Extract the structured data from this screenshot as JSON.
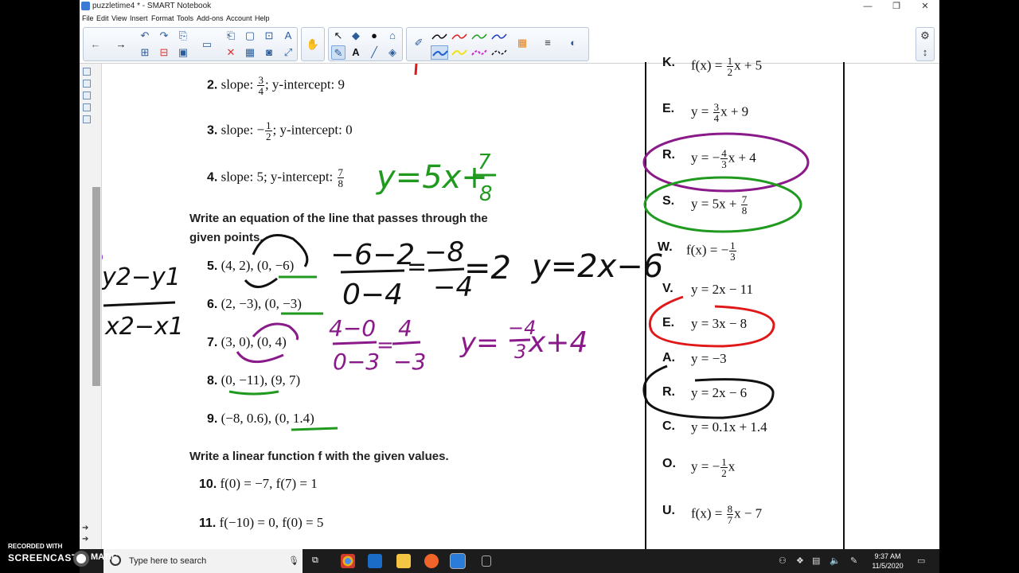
{
  "window": {
    "title": "puzzletime4 * - SMART Notebook",
    "controls": [
      "—",
      "❐",
      "✕"
    ]
  },
  "menu": [
    "File",
    "Edit",
    "View",
    "Insert",
    "Format",
    "Tools",
    "Add-ons",
    "Account",
    "Help"
  ],
  "toolbar": {
    "pen_colors": [
      "#111111",
      "#e02020",
      "#22a022",
      "#2040c0",
      "#1f5fd0",
      "#f2e21a",
      "#d020d0",
      "#111111"
    ]
  },
  "worksheet": {
    "slope_problems": [
      {
        "num": "2.",
        "pre": "slope: ",
        "frac": [
          "3",
          "4"
        ],
        "post": "; y-intercept: 9"
      },
      {
        "num": "3.",
        "pre": "slope: −",
        "frac": [
          "1",
          "2"
        ],
        "post": "; y-intercept: 0"
      },
      {
        "num": "4.",
        "pre": "slope: 5; y-intercept: ",
        "frac": [
          "7",
          "8"
        ],
        "post": ""
      }
    ],
    "heading_points_line1": "Write an equation of the line that passes through the",
    "heading_points_line2": "given points.",
    "point_problems": [
      {
        "num": "5.",
        "text": "(4, 2), (0, −6)"
      },
      {
        "num": "6.",
        "text": "(2, −3), (0, −3)"
      },
      {
        "num": "7.",
        "text": "(3, 0), (0, 4)"
      },
      {
        "num": "8.",
        "text": "(0, −11), (9, 7)"
      },
      {
        "num": "9.",
        "text": "(−8, 0.6), (0, 1.4)"
      }
    ],
    "heading_function": "Write a linear function f with the given values.",
    "function_problems": [
      {
        "num": "10.",
        "text": "f(0) = −7, f(7) = 1"
      },
      {
        "num": "11.",
        "text": "f(−10) = 0, f(0) = 5"
      }
    ]
  },
  "answers": [
    {
      "letter": "K.",
      "pre": "f(x) = ",
      "frac": [
        "1",
        "2"
      ],
      "post": "x + 5"
    },
    {
      "letter": "E.",
      "pre": "y = ",
      "frac": [
        "3",
        "4"
      ],
      "post": "x + 9"
    },
    {
      "letter": "R.",
      "pre": "y = −",
      "frac": [
        "4",
        "3"
      ],
      "post": "x + 4"
    },
    {
      "letter": "S.",
      "pre": "y = 5x + ",
      "frac": [
        "7",
        "8"
      ],
      "post": ""
    },
    {
      "letter": "W.",
      "pre": "f(x) = −",
      "frac": [
        "1",
        "3"
      ],
      "post": ""
    },
    {
      "letter": "V.",
      "pre": "y = 2x − 11",
      "frac": null,
      "post": ""
    },
    {
      "letter": "E.",
      "pre": "y = 3x − 8",
      "frac": null,
      "post": ""
    },
    {
      "letter": "A.",
      "pre": "y = −3",
      "frac": null,
      "post": ""
    },
    {
      "letter": "R.",
      "pre": "y = 2x − 6",
      "frac": null,
      "post": ""
    },
    {
      "letter": "C.",
      "pre": "y = 0.1x + 1.4",
      "frac": null,
      "post": ""
    },
    {
      "letter": "O.",
      "pre": "y = −",
      "frac": [
        "1",
        "2"
      ],
      "post": "x"
    },
    {
      "letter": "U.",
      "pre": "f(x) = ",
      "frac": [
        "8",
        "7"
      ],
      "post": "x − 7"
    }
  ],
  "ink": {
    "eq4": "y=5x+",
    "eq4_frac": [
      "7",
      "8"
    ],
    "slope_formula": [
      "y2−y1",
      "x2−x1"
    ],
    "p5_calc": [
      "−6−2",
      "0−4",
      "=",
      "−8",
      "−4",
      "=2"
    ],
    "p5_answer": "y=2x−6",
    "p7_calc": [
      "4−0",
      "0−3",
      "=",
      "4",
      "−3"
    ],
    "p7_answer_pre": "y=",
    "p7_answer_frac": [
      "−4",
      "3"
    ],
    "p7_answer_post": "x+4",
    "colors": {
      "green": "#1f9a1f",
      "purple": "#8a1a8a",
      "black": "#111111",
      "red": "#e01818"
    }
  },
  "taskbar": {
    "search_placeholder": "Type here to search",
    "time": "9:37 AM",
    "date": "11/5/2020"
  },
  "watermark": {
    "line1": "RECORDED WITH",
    "line2": "SCREENCAST",
    "line3": "MATIC"
  }
}
